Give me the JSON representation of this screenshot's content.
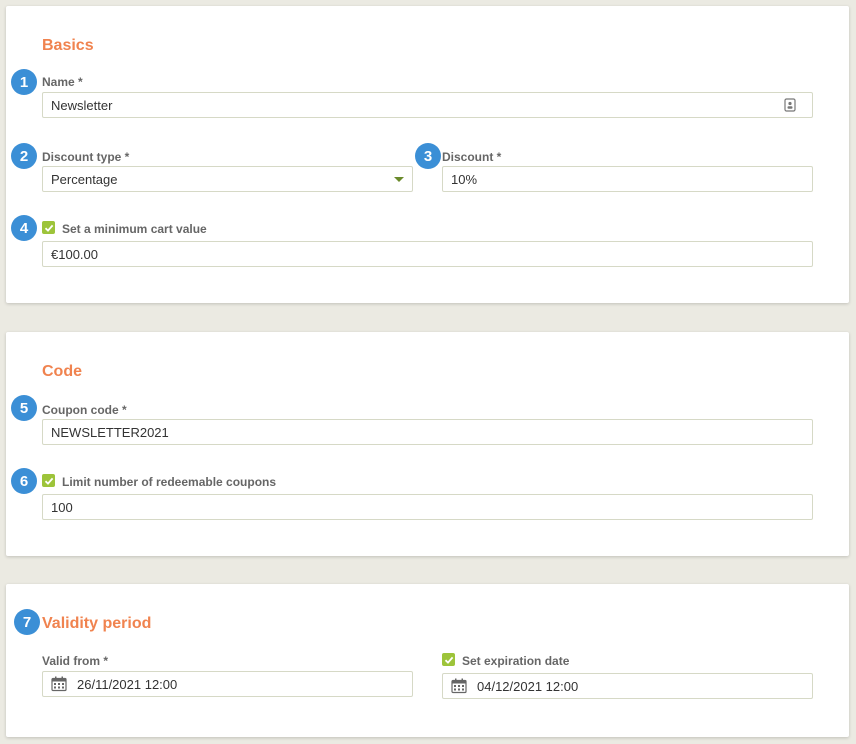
{
  "colors": {
    "accent": "#f0834f",
    "badge": "#3b8fd6",
    "checkbox": "#9dc43a"
  },
  "basics": {
    "title": "Basics",
    "name_label": "Name *",
    "name_value": "Newsletter",
    "discount_type_label": "Discount type *",
    "discount_type_value": "Percentage",
    "discount_label": "Discount *",
    "discount_value": "10%",
    "min_cart_label": "Set a minimum cart value",
    "min_cart_checked": true,
    "min_cart_value": "€100.00"
  },
  "code": {
    "title": "Code",
    "coupon_label": "Coupon code *",
    "coupon_value": "NEWSLETTER2021",
    "limit_label": "Limit number of redeemable coupons",
    "limit_checked": true,
    "limit_value": "100"
  },
  "validity": {
    "title": "Validity period",
    "valid_from_label": "Valid from *",
    "valid_from_value": "26/11/2021 12:00",
    "expiration_label": "Set expiration date",
    "expiration_checked": true,
    "expiration_value": "04/12/2021 12:00"
  },
  "badges": [
    "1",
    "2",
    "3",
    "4",
    "5",
    "6",
    "7"
  ],
  "icons": {
    "name_field": "contact-card-icon",
    "discount_type": "chevron-down-icon",
    "date": "calendar-icon",
    "checkbox": "checkmark-icon"
  }
}
